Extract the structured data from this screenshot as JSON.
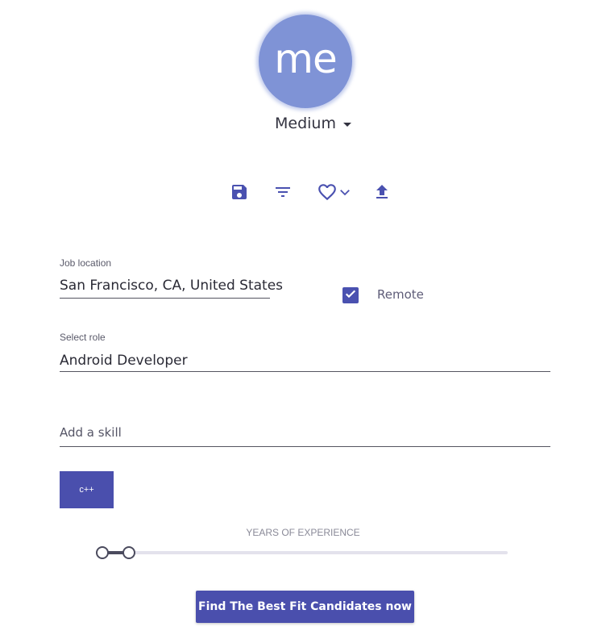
{
  "profile": {
    "avatar_text": "me",
    "level": "Medium"
  },
  "toolbar": {
    "icons": [
      "save-icon",
      "filter-icon",
      "heart-icon",
      "chevron-down-icon",
      "upload-icon"
    ],
    "accent_color": "#4a51b0"
  },
  "job_location": {
    "label": "Job location",
    "value": "San Francisco, CA, United States"
  },
  "remote": {
    "label": "Remote",
    "checked": true
  },
  "role": {
    "label": "Select role",
    "value": "Android Developer"
  },
  "skill": {
    "placeholder": "Add a skill",
    "chips": [
      "c++"
    ]
  },
  "experience": {
    "caption": "YEARS OF EXPERIENCE",
    "range": [
      0,
      1
    ]
  },
  "cta": {
    "label": "Find The Best Fit Candidates now"
  },
  "colors": {
    "primary": "#4a4fad",
    "avatar": "#7f93d6"
  }
}
